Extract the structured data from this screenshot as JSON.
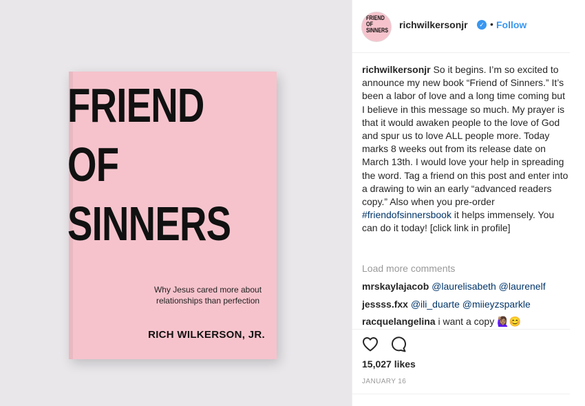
{
  "book": {
    "title_lines": [
      "FRIEND",
      "OF",
      "SINNERS"
    ],
    "subtitle": "Why Jesus cared more about relationships than perfection",
    "author": "RICH WILKERSON, JR."
  },
  "header": {
    "avatar_text": "FRIEND OF SINNERS",
    "username": "richwilkersonjr",
    "dot": "•",
    "follow_label": "Follow"
  },
  "caption": {
    "username": "richwilkersonjr",
    "text_part1": " So it begins. I’m so excited to announce my new book “Friend of Sinners.” It’s been a labor of love and a long time coming but I believe in this message so much. My prayer is that it would awaken people to the love of God and spur us to love ALL people more. Today marks 8 weeks out from its release date on March 13th. I would love your help in spreading the word. Tag a friend on this post and enter into a drawing to win an early “advanced readers copy.” Also when you pre-order ",
    "hashtag": "#friendofsinnersbook",
    "text_part2": " it helps immensely. You can do it today! [click link in profile]"
  },
  "load_more_label": "Load more comments",
  "comments": [
    {
      "user": "mrskaylajacob",
      "text": "@laurelisabeth @laurenelf"
    },
    {
      "user": "jessss.fxx",
      "text": "@ili_duarte @miieyzsparkle"
    },
    {
      "user": "racquelangelina",
      "text": "i want a copy 🙋🏽‍♀️😊"
    }
  ],
  "likes": "15,027 likes",
  "date": "JANUARY 16",
  "colors": {
    "accent": "#3897f0",
    "mention": "#003569",
    "book_pink": "#f6c3cc",
    "background_left": "#e9e7ea"
  },
  "icons": [
    "check-icon",
    "heart-icon",
    "comment-icon"
  ]
}
